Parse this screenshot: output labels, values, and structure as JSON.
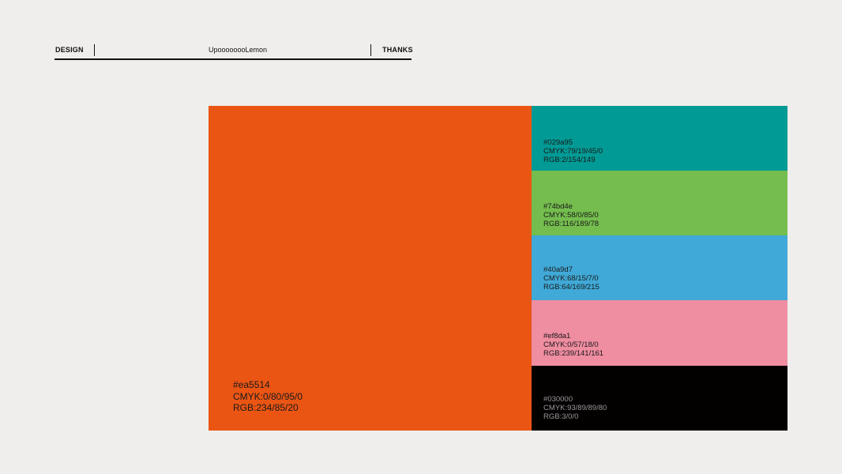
{
  "header": {
    "left_label": "DESIGN",
    "center_label": "UpoooooooLemon",
    "right_label": "THANKS"
  },
  "palette": {
    "main": {
      "color": "#ea5514",
      "hex": "#ea5514",
      "cmyk": "CMYK:0/80/95/0",
      "rgb": "RGB:234/85/20"
    },
    "side": [
      {
        "color": "#029a95",
        "hex": "#029a95",
        "cmyk": "CMYK:79/19/45/0",
        "rgb": "RGB:2/154/149"
      },
      {
        "color": "#74bd4e",
        "hex": "#74bd4e",
        "cmyk": "CMYK:58/0/85/0",
        "rgb": "RGB:116/189/78"
      },
      {
        "color": "#40a9d7",
        "hex": "#40a9d7",
        "cmyk": "CMYK:68/15/7/0",
        "rgb": "RGB:64/169/215"
      },
      {
        "color": "#ef8da1",
        "hex": "#ef8da1",
        "cmyk": "CMYK:0/57/18/0",
        "rgb": "RGB:239/141/161"
      },
      {
        "color": "#030000",
        "hex": "#030000",
        "cmyk": "CMYK:93/89/89/80",
        "rgb": "RGB:3/0/0"
      }
    ]
  }
}
